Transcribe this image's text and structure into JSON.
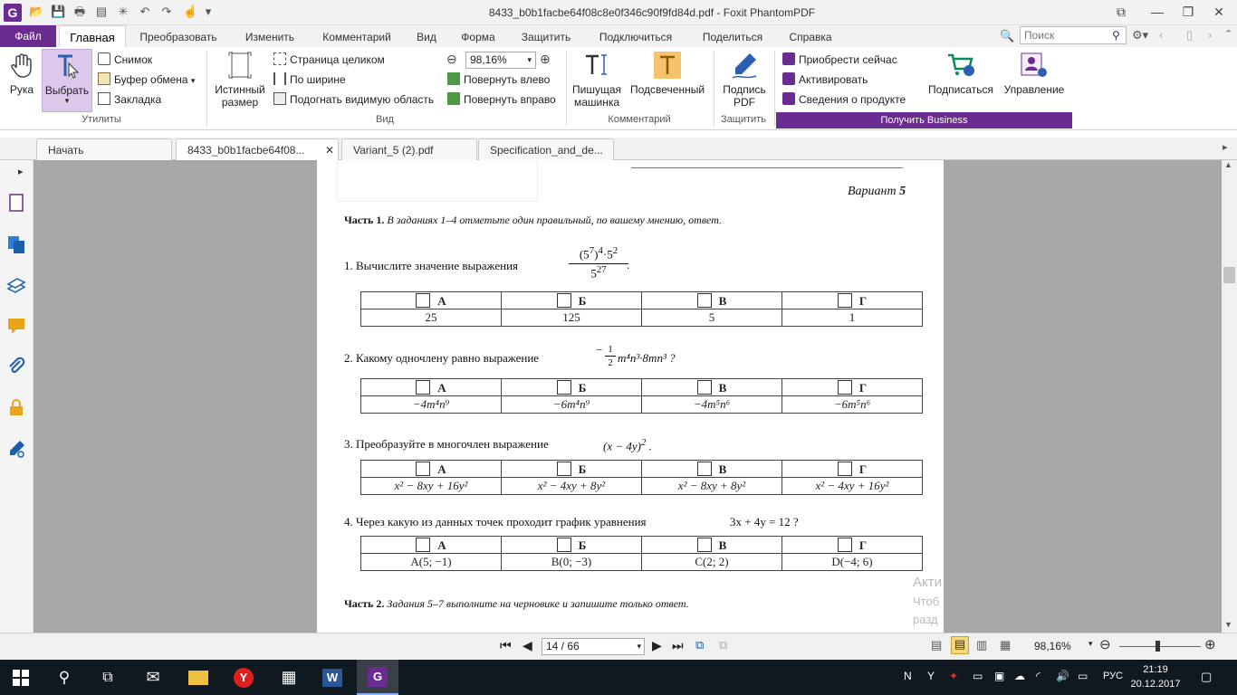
{
  "window": {
    "title": "8433_b0b1facbe64f08c8e0f346c90f9fd84d.pdf - Foxit PhantomPDF",
    "logo_letter": "G"
  },
  "menu": {
    "file": "Файл",
    "tabs": [
      "Главная",
      "Преобразовать",
      "Изменить",
      "Комментарий",
      "Вид",
      "Форма",
      "Защитить",
      "Подключиться",
      "Поделиться",
      "Справка"
    ],
    "search_placeholder": "Поиск"
  },
  "ribbon": {
    "hand": "Рука",
    "select": "Выбрать",
    "snapshot": "Снимок",
    "clipboard": "Буфер обмена",
    "bookmark": "Закладка",
    "utilities_label": "Утилиты",
    "actual_size_1": "Истинный",
    "actual_size_2": "размер",
    "fit_page": "Страница целиком",
    "fit_width": "По ширине",
    "fit_visible": "Подогнать видимую область",
    "zoom": "98,16%",
    "rotate_left": "Повернуть влево",
    "rotate_right": "Повернуть вправо",
    "view_label": "Вид",
    "typewriter_1": "Пишущая",
    "typewriter_2": "машинка",
    "highlight": "Подсвеченный",
    "comment_label": "Комментарий",
    "sign_1": "Подпись",
    "sign_2": "PDF",
    "protect_label": "Защитить",
    "buy_now": "Приобрести сейчас",
    "activate": "Активировать",
    "product_info": "Сведения о продукте",
    "subscribe": "Подписаться",
    "manage": "Управление",
    "get_business": "Получить Business"
  },
  "doc_tabs": [
    "Начать",
    "8433_b0b1facbe64f08...",
    "Variant_5 (2).pdf",
    "Specification_and_de..."
  ],
  "document": {
    "variant": "Вариант",
    "variant_num": "5",
    "part1_label": "Часть 1.",
    "part1_text": "В заданиях 1–4 отметьте один правильный, по вашему мнению, ответ.",
    "q1": "1. Вычислите значение выражения",
    "q2": "2. Какому одночлену равно выражение",
    "q3": "3. Преобразуйте в многочлен выражение",
    "q4": "4. Через какую из данных точек проходит график уравнения",
    "q4_expr": "3x + 4y = 12 ?",
    "q3_expr": "(x − 4y)",
    "q2_expr": "m⁴n³·8mn³ ?",
    "options": [
      "А",
      "Б",
      "В",
      "Г"
    ],
    "a1": [
      "25",
      "125",
      "5",
      "1"
    ],
    "a2": [
      "−4m⁴n⁹",
      "−6m⁴n⁹",
      "−4m⁵n⁶",
      "−6m⁵n⁶"
    ],
    "a3": [
      "x² − 8xy + 16y²",
      "x² − 4xy + 8y²",
      "x² − 8xy + 8y²",
      "x² − 4xy + 16y²"
    ],
    "a4": [
      "A(5; −1)",
      "B(0; −3)",
      "C(2; 2)",
      "D(−4; 6)"
    ],
    "part2_label": "Часть 2.",
    "part2_text": "Задания 5–7 выполните на черновике и запишите только ответ.",
    "watermark_1": "Акти",
    "watermark_2": "Чтоб",
    "watermark_3": "разд"
  },
  "status": {
    "page": "14 / 66",
    "zoom": "98,16%"
  },
  "taskbar": {
    "lang": "РУС",
    "time": "21:19",
    "date": "20.12.2017"
  }
}
